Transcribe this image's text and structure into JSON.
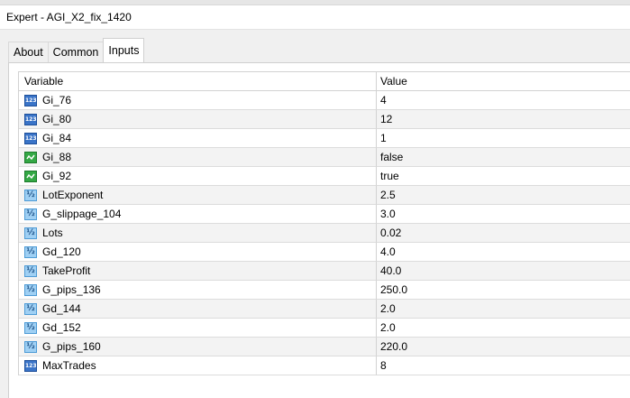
{
  "window": {
    "title": "Expert - AGI_X2_fix_1420"
  },
  "tabs": [
    {
      "label": "About",
      "active": false
    },
    {
      "label": "Common",
      "active": false
    },
    {
      "label": "Inputs",
      "active": true
    }
  ],
  "table": {
    "headers": {
      "variable": "Variable",
      "value": "Value"
    },
    "rows": [
      {
        "icon": "integer-icon",
        "variable": "Gi_76",
        "value": "4"
      },
      {
        "icon": "integer-icon",
        "variable": "Gi_80",
        "value": "12"
      },
      {
        "icon": "integer-icon",
        "variable": "Gi_84",
        "value": "1"
      },
      {
        "icon": "boolean-icon",
        "variable": "Gi_88",
        "value": "false"
      },
      {
        "icon": "boolean-icon",
        "variable": "Gi_92",
        "value": "true"
      },
      {
        "icon": "double-icon",
        "variable": "LotExponent",
        "value": "2.5"
      },
      {
        "icon": "double-icon",
        "variable": "G_slippage_104",
        "value": "3.0"
      },
      {
        "icon": "double-icon",
        "variable": "Lots",
        "value": "0.02"
      },
      {
        "icon": "double-icon",
        "variable": "Gd_120",
        "value": "4.0"
      },
      {
        "icon": "double-icon",
        "variable": "TakeProfit",
        "value": "40.0"
      },
      {
        "icon": "double-icon",
        "variable": "G_pips_136",
        "value": "250.0"
      },
      {
        "icon": "double-icon",
        "variable": "Gd_144",
        "value": "2.0"
      },
      {
        "icon": "double-icon",
        "variable": "Gd_152",
        "value": "2.0"
      },
      {
        "icon": "double-icon",
        "variable": "G_pips_160",
        "value": "220.0"
      },
      {
        "icon": "integer-icon",
        "variable": "MaxTrades",
        "value": "8"
      }
    ]
  }
}
